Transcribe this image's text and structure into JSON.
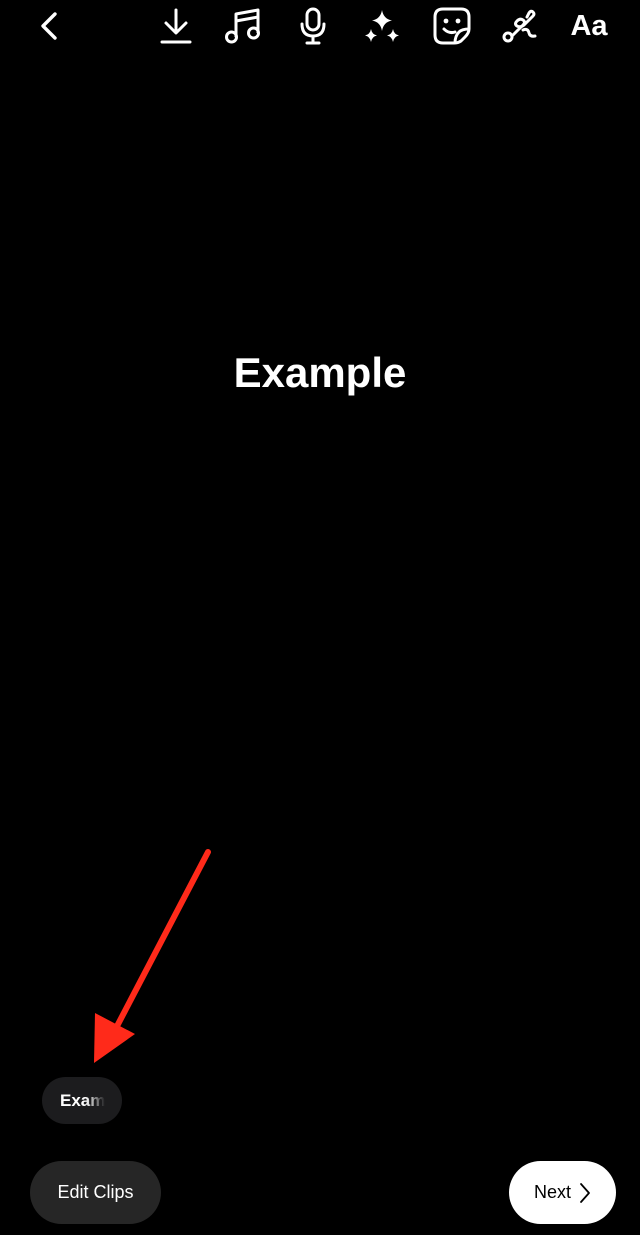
{
  "toolbar": {
    "back_icon": "chevron-left-icon",
    "download_icon": "download-icon",
    "music_icon": "music-note-icon",
    "voiceover_icon": "microphone-icon",
    "effects_icon": "sparkles-icon",
    "sticker_icon": "sticker-icon",
    "draw_icon": "draw-squiggle-icon",
    "text_label": "Aa"
  },
  "canvas": {
    "text": "Example"
  },
  "clip_chip": {
    "label": "Exam"
  },
  "bottom": {
    "edit_clips_label": "Edit Clips",
    "next_label": "Next",
    "next_icon": "chevron-right-icon"
  },
  "colors": {
    "background": "#000000",
    "annotation_arrow": "#ff2a1a",
    "button_dark": "#262626",
    "button_light": "#ffffff"
  }
}
